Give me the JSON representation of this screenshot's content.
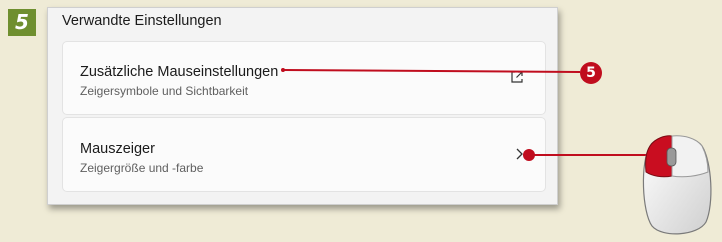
{
  "step_badge": "5",
  "section": {
    "title": "Verwandte Einstellungen"
  },
  "items": [
    {
      "title": "Zusätzliche Mauseinstellungen",
      "subtitle": "Zeigersymbole und Sichtbarkeit",
      "icon": "external-link-icon"
    },
    {
      "title": "Mauszeiger",
      "subtitle": "Zeigergröße und -farbe",
      "icon": "chevron-right-icon"
    }
  ],
  "callout": {
    "number": "5",
    "color": "#c00d1e"
  },
  "colors": {
    "accent_green": "#6f8f2f",
    "callout_red": "#c00d1e",
    "background": "#efebd6"
  }
}
